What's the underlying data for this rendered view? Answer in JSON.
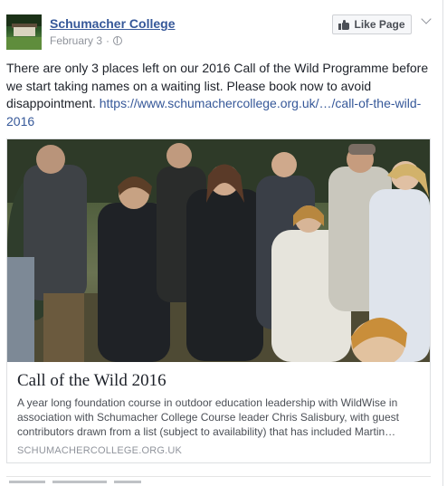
{
  "post": {
    "page_name": "Schumacher College",
    "date": "February 3",
    "privacy_separator": "·",
    "like_page_label": "Like Page",
    "text_before_link": "There are only 3 places left on our 2016 Call of the Wild Programme before we start taking names on a waiting list. Please book now to avoid disappointment. ",
    "link_text": "https://www.schumachercollege.org.uk/…/call-of-the-wild-2016"
  },
  "attachment": {
    "title": "Call of the Wild 2016",
    "description": "A year long foundation course in outdoor education leadership with WildWise in association with Schumacher College Course leader Chris Salisbury, with guest contributors drawn from a list (subject to availability) that has included Martin…",
    "domain": "SCHUMACHERCOLLEGE.ORG.UK"
  },
  "colors": {
    "link": "#365899",
    "text": "#1d2129",
    "muted": "#90949c"
  },
  "icons": [
    "globe-icon",
    "thumb-up-icon",
    "chevron-down-icon"
  ]
}
